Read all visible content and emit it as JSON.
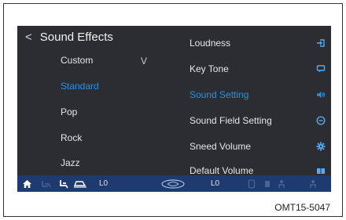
{
  "header": {
    "back_glyph": "<",
    "title": "Sound Effects"
  },
  "sound_list": [
    {
      "label": "Custom",
      "selected": false
    },
    {
      "label": "Standard",
      "selected": true
    },
    {
      "label": "Pop",
      "selected": false
    },
    {
      "label": "Rock",
      "selected": false
    },
    {
      "label": "Jazz",
      "selected": false
    }
  ],
  "custom_chevron": "V",
  "menu": [
    {
      "label": "Loudness",
      "icon": "exit-arrow-icon",
      "selected": false
    },
    {
      "label": "Key Tone",
      "icon": "speech-bubble-icon",
      "selected": false
    },
    {
      "label": "Sound Setting",
      "icon": "speaker-icon",
      "selected": true
    },
    {
      "label": "Sound Field Setting",
      "icon": "circle-target-icon",
      "selected": false
    },
    {
      "label": "Sneed Volume",
      "icon": "gear-icon",
      "selected": false
    },
    {
      "label": "Default Volume",
      "icon": "book-icon",
      "selected": false
    }
  ],
  "bottom_bar": {
    "left_level": "L0",
    "right_level": "L0"
  },
  "colors": {
    "accent": "#2f8fd8",
    "screen_bg": "#2b2d33",
    "bar_bg": "#1e3a6e"
  },
  "figure_code": "OMT15-5047"
}
